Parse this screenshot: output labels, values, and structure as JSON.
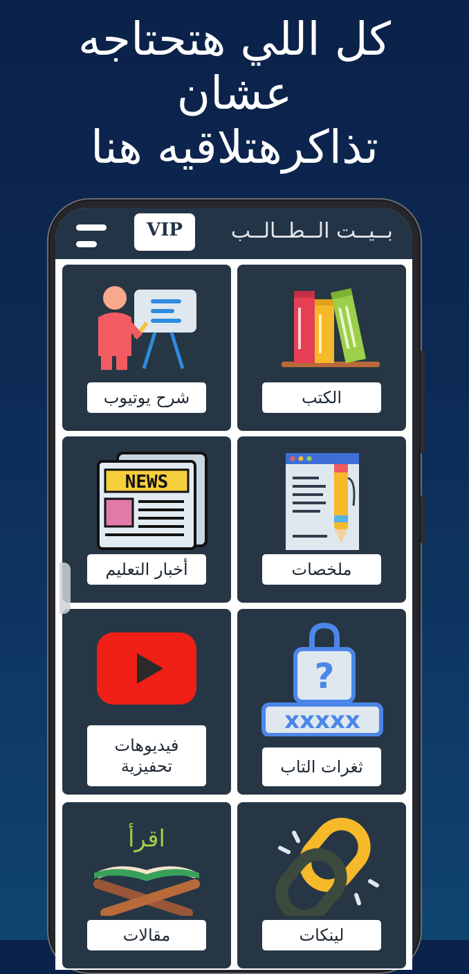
{
  "headline": {
    "line1": "كل اللي هتحتاجه",
    "line2": "عشان",
    "line3": "تذاكرهتلاقيه هنا"
  },
  "appbar": {
    "title": "بــيــت الــطــالــب",
    "vip_label": "VIP",
    "menu_icon": "hamburger-menu-icon"
  },
  "tiles": [
    {
      "label": "الكتب",
      "icon": "books-icon"
    },
    {
      "label": "شرح يوتيوب",
      "icon": "teacher-whiteboard-icon"
    },
    {
      "label": "ملخصات",
      "icon": "document-pencil-icon"
    },
    {
      "label": "أخبار التعليم",
      "icon": "newspaper-icon"
    },
    {
      "label": "ثغرات التاب",
      "icon": "locked-password-icon"
    },
    {
      "label": "فيديوهات تحفيزية",
      "icon": "youtube-play-icon"
    },
    {
      "label": "لينكات",
      "icon": "chain-link-icon"
    },
    {
      "label": "مقالات",
      "icon": "quran-stand-icon"
    }
  ],
  "art_text": {
    "news": "NEWS",
    "iqra": "اقرأ",
    "password_mask": "xxxxx"
  },
  "colors": {
    "background": "#0b2149",
    "appbar": "#243447",
    "tile": "#263645",
    "label_bg": "#ffffff"
  }
}
